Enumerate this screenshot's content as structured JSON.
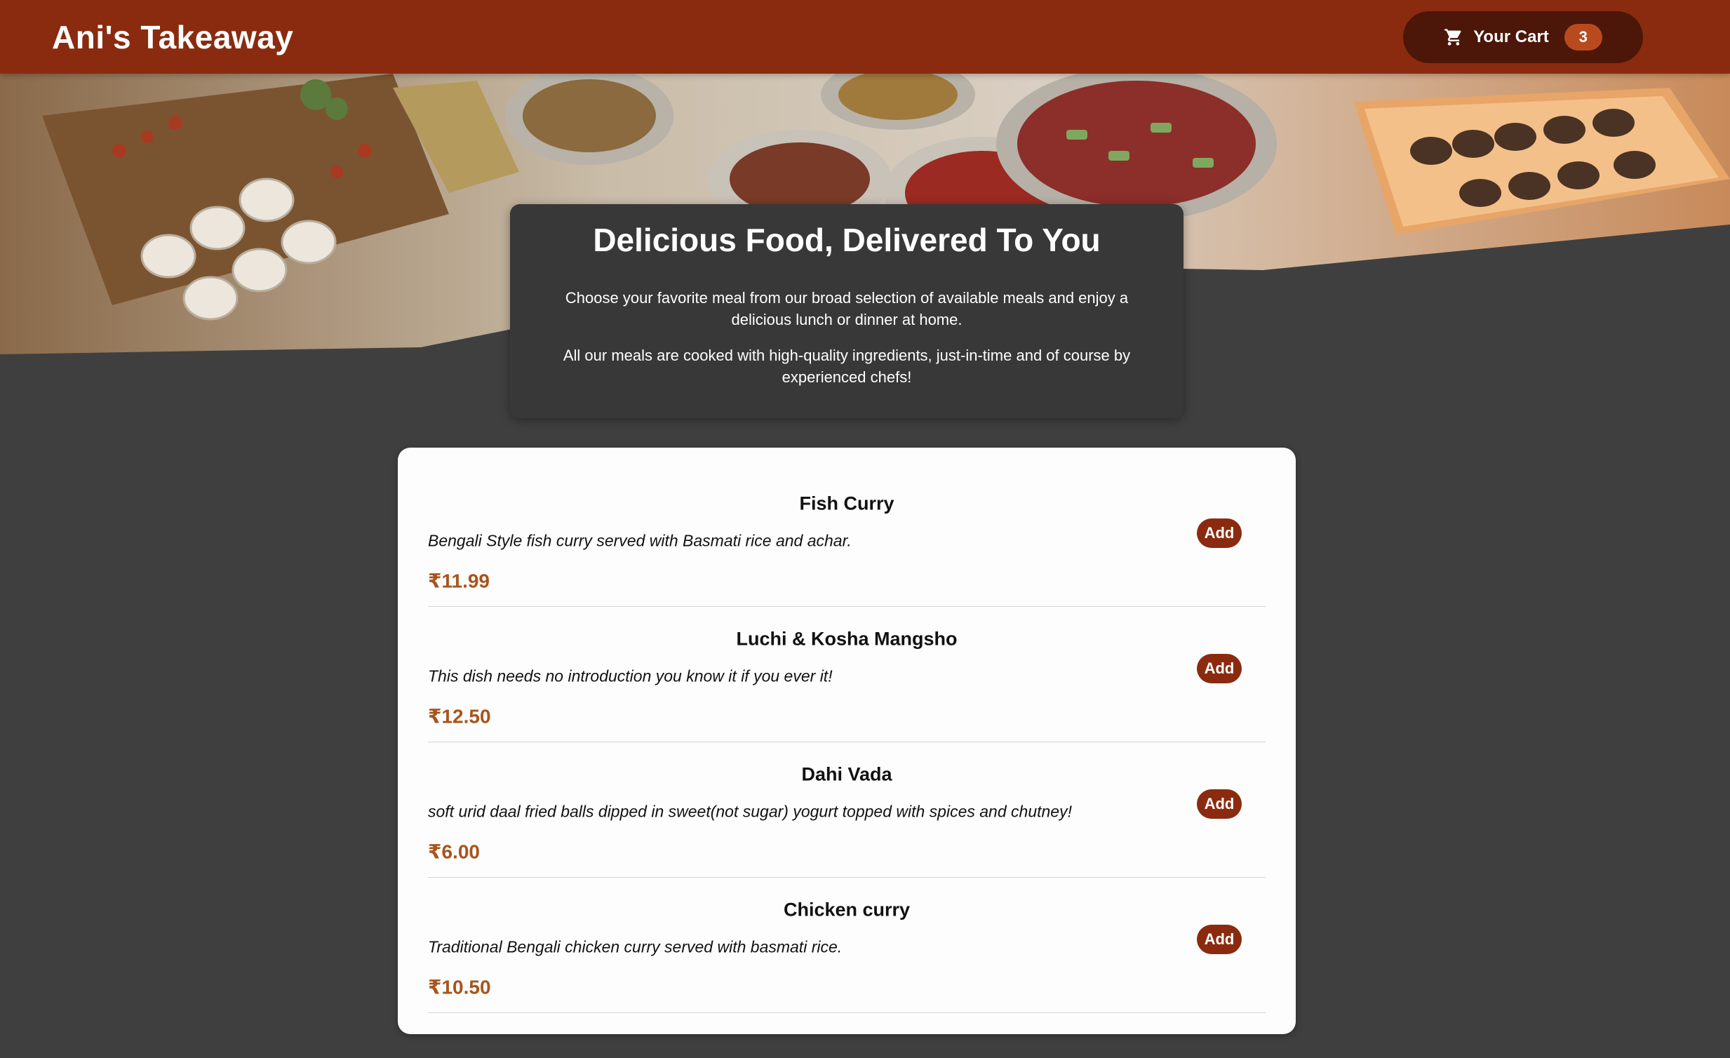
{
  "header": {
    "title": "Ani's Takeaway",
    "cart": {
      "label": "Your Cart",
      "count": "3"
    }
  },
  "hero": {
    "image_description_icon": "food-buffet-image"
  },
  "summary": {
    "title": "Delicious Food, Delivered To You",
    "paragraph1": "Choose your favorite meal from our broad selection of available meals and enjoy a delicious lunch or dinner at home.",
    "paragraph2": "All our meals are cooked with high-quality ingredients, just-in-time and of course by experienced chefs!"
  },
  "meals": [
    {
      "name": "Fish Curry",
      "description": "Bengali Style fish curry served with Basmati rice and achar.",
      "price": "₹11.99",
      "add_label": "Add"
    },
    {
      "name": "Luchi & Kosha Mangsho",
      "description": "This dish needs no introduction you know it if you ever it!",
      "price": "₹12.50",
      "add_label": "Add"
    },
    {
      "name": "Dahi Vada",
      "description": "soft urid daal fried balls dipped in sweet(not sugar) yogurt topped with spices and chutney!",
      "price": "₹6.00",
      "add_label": "Add"
    },
    {
      "name": "Chicken curry",
      "description": "Traditional Bengali chicken curry served with basmati rice.",
      "price": "₹10.50",
      "add_label": "Add"
    }
  ],
  "colors": {
    "header": "#8a2b0f",
    "cart_button": "#4c1608",
    "badge": "#b94a1e",
    "price": "#a8541c",
    "background": "#3f3f3f"
  }
}
